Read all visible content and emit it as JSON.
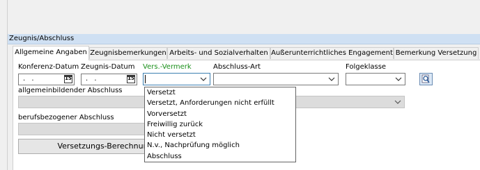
{
  "group": {
    "title": "Zeugnis/Abschluss"
  },
  "tabs": [
    {
      "label": "Allgemeine Angaben",
      "active": true
    },
    {
      "label": "Zeugnisbemerkungen",
      "active": false
    },
    {
      "label": "Arbeits- und Sozialverhalten",
      "active": false
    },
    {
      "label": "Außerunterrichtliches Engagement",
      "active": false
    },
    {
      "label": "Bemerkung Versetzung",
      "active": false
    }
  ],
  "form": {
    "konferenz_label": "Konferenz-Datum",
    "konferenz_value": ". .",
    "zeugnis_label": "Zeugnis-Datum",
    "zeugnis_value": ". .",
    "calendar_glyph": "15",
    "vermerk_label": "Vers.-Vermerk",
    "vermerk_value": "",
    "abschlussart_label": "Abschluss-Art",
    "abschlussart_value": "",
    "folgeklasse_label": "Folgeklasse",
    "folgeklasse_value": "",
    "allgemein_label": "allgemeinbildender Abschluss",
    "beruf_label": "berufsbezogener Abschluss",
    "versetzung_button": "Versetzungs-Berechnung"
  },
  "dropdown": {
    "items": [
      "Versetzt",
      "Versetzt, Anforderungen nicht erfüllt",
      "Vorversetzt",
      "Freiwillig zurück",
      "Nicht versetzt",
      "N.v., Nachprüfung möglich",
      "Abschluss"
    ]
  },
  "colors": {
    "accent_label": "#1a8f1a",
    "group_header": "#cfe0f3"
  }
}
